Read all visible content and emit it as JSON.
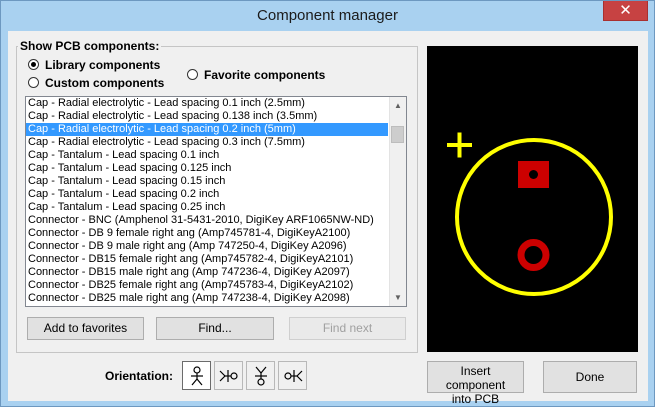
{
  "window": {
    "title": "Component manager",
    "close_glyph": "✕"
  },
  "group": {
    "label": "Show PCB components:",
    "radios": [
      {
        "label": "Library components",
        "checked": true
      },
      {
        "label": "Custom components",
        "checked": false
      },
      {
        "label": "Favorite components",
        "checked": false
      }
    ]
  },
  "list": {
    "selected_index": 2,
    "items": [
      "Cap - Radial electrolytic - Lead spacing  0.1 inch  (2.5mm)",
      "Cap - Radial electrolytic - Lead spacing  0.138 inch  (3.5mm)",
      "Cap - Radial electrolytic - Lead spacing  0.2 inch  (5mm)",
      "Cap - Radial electrolytic - Lead spacing  0.3 inch  (7.5mm)",
      "Cap - Tantalum - Lead spacing  0.1 inch",
      "Cap - Tantalum - Lead spacing  0.125 inch",
      "Cap - Tantalum - Lead spacing  0.15 inch",
      "Cap - Tantalum - Lead spacing  0.2 inch",
      "Cap - Tantalum - Lead spacing  0.25 inch",
      "Connector - BNC (Amphenol 31-5431-2010, DigiKey ARF1065NW-ND)",
      "Connector - DB 9 female right ang (Amp745781-4, DigiKeyA2100)",
      "Connector - DB 9 male right ang (Amp 747250-4, DigiKey A2096)",
      "Connector - DB15 female right ang (Amp745782-4, DigiKeyA2101)",
      "Connector - DB15 male right ang (Amp 747236-4, DigiKey A2097)",
      "Connector - DB25 female right ang (Amp745783-4, DigiKeyA2102)",
      "Connector - DB25 male right ang (Amp 747238-4, DigiKey A2098)"
    ]
  },
  "buttons": {
    "add_favorites": "Add to favorites",
    "find": "Find...",
    "find_next": "Find next",
    "insert": "Insert component into PCB",
    "done": "Done"
  },
  "orientation": {
    "label": "Orientation:",
    "icons": [
      "orient-up-icon",
      "orient-left-icon",
      "orient-down-icon",
      "orient-right-icon"
    ],
    "selected": 0
  },
  "preview": {
    "background": "#000000",
    "outline_color": "#ffff00",
    "pad_color": "#cc0000",
    "plus_color": "#ffff00"
  }
}
